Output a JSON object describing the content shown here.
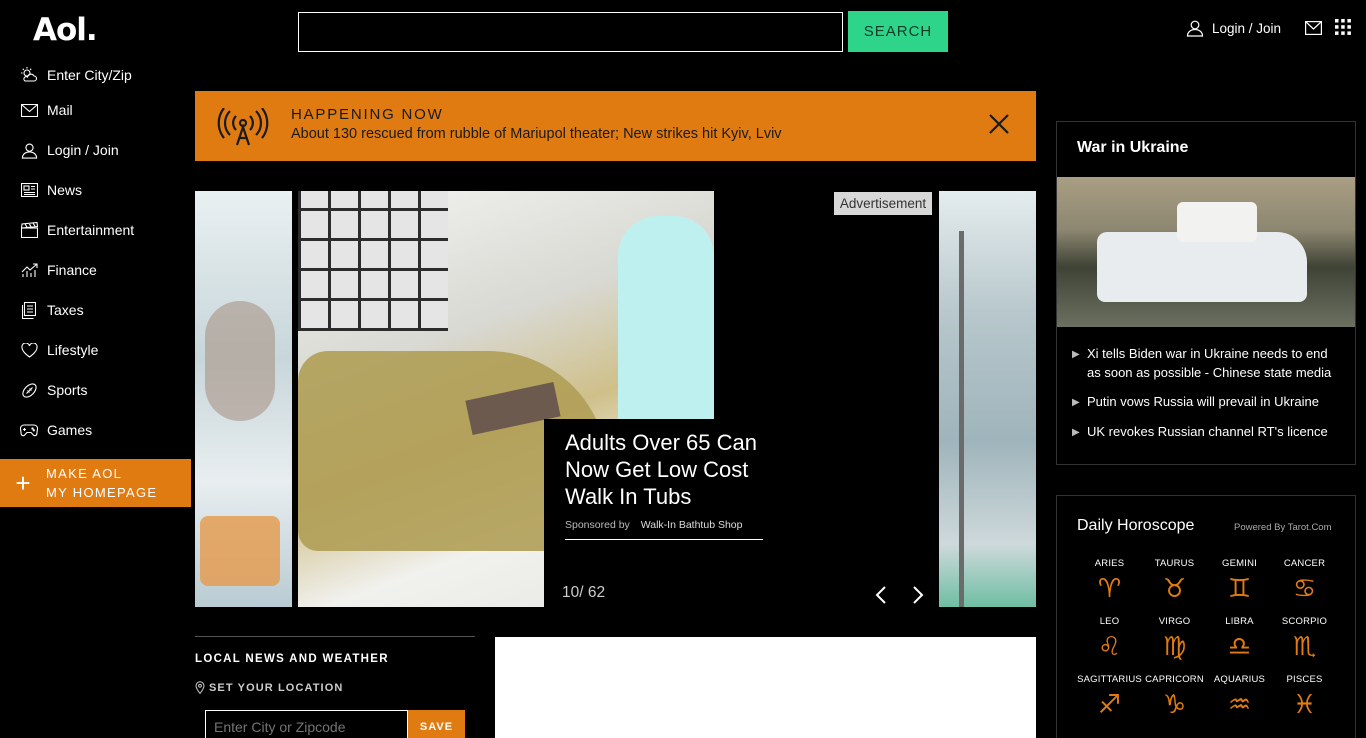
{
  "header": {
    "logo": "Aol.",
    "search_placeholder": "",
    "search_button": "SEARCH",
    "login_label": "Login / Join"
  },
  "sidebar": {
    "items": [
      {
        "label": "Enter City/Zip",
        "icon": "weather-icon"
      },
      {
        "label": "Mail",
        "icon": "mail-icon"
      },
      {
        "label": "Login / Join",
        "icon": "user-icon"
      },
      {
        "label": "News",
        "icon": "news-icon"
      },
      {
        "label": "Entertainment",
        "icon": "clapperboard-icon"
      },
      {
        "label": "Finance",
        "icon": "chart-icon"
      },
      {
        "label": "Taxes",
        "icon": "document-icon"
      },
      {
        "label": "Lifestyle",
        "icon": "heart-icon"
      },
      {
        "label": "Sports",
        "icon": "football-icon"
      },
      {
        "label": "Games",
        "icon": "gamepad-icon"
      }
    ],
    "make_home_line1": "MAKE AOL",
    "make_home_line2": "MY HOMEPAGE"
  },
  "banner": {
    "label": "HAPPENING NOW",
    "headline": "About 130 rescued from rubble of Mariupol theater; New strikes hit Kyiv, Lviv"
  },
  "carousel": {
    "ad_title": "Adults Over 65 Can Now Get Low Cost Walk In Tubs",
    "sponsored_by": "Sponsored by",
    "sponsor_name": "Walk-In Bathtub Shop",
    "advertisement_tag": "Advertisement",
    "counter": "10/ 62"
  },
  "local": {
    "title": "LOCAL NEWS AND WEATHER",
    "set_location": "SET YOUR LOCATION",
    "input_placeholder": "Enter City or Zipcode",
    "save_button": "SAVE"
  },
  "ukraine": {
    "title": "War in Ukraine",
    "stories": [
      "Xi tells Biden war in Ukraine needs to end as soon as possible - Chinese state media",
      "Putin vows Russia will prevail in Ukraine",
      "UK revokes Russian channel RT's licence"
    ]
  },
  "horoscope": {
    "title": "Daily Horoscope",
    "powered_by": "Powered By Tarot.Com",
    "signs": [
      "ARIES",
      "TAURUS",
      "GEMINI",
      "CANCER",
      "LEO",
      "VIRGO",
      "LIBRA",
      "SCORPIO",
      "SAGITTARIUS",
      "CAPRICORN",
      "AQUARIUS",
      "PISCES"
    ],
    "glyphs": [
      "♈",
      "♉",
      "♊",
      "♋",
      "♌",
      "♍",
      "♎",
      "♏",
      "♐",
      "♑",
      "♒",
      "♓"
    ]
  },
  "colors": {
    "accent_orange": "#e07b12",
    "search_green": "#2ed48a",
    "background": "#000000"
  }
}
